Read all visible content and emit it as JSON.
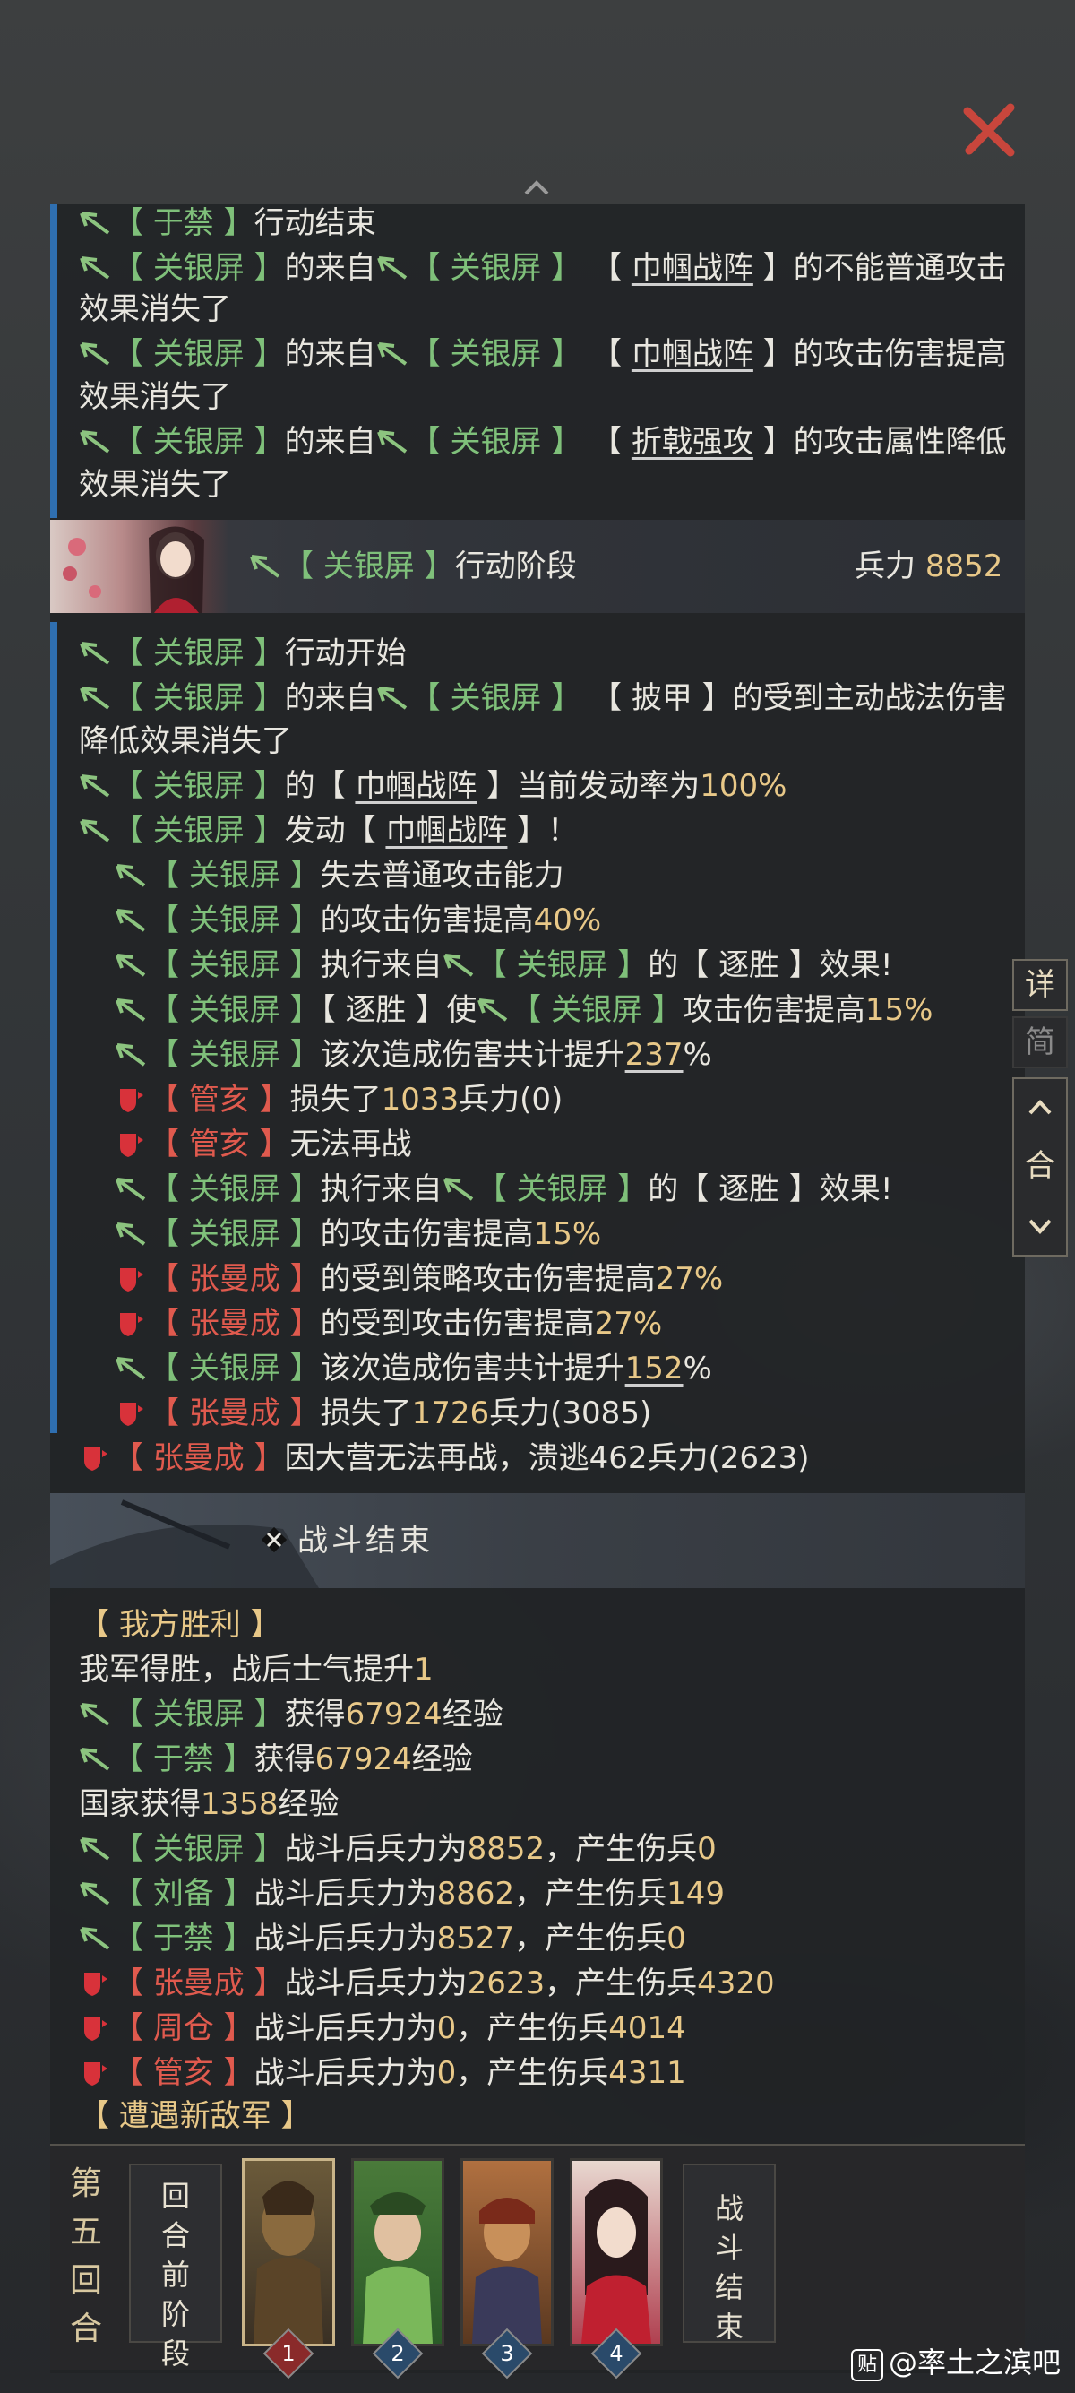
{
  "colors": {
    "ally": "#7fc07a",
    "enemy": "#e05a4e",
    "number": "#e8c888",
    "accent": "#2f6fb0"
  },
  "icons": {
    "ally": "banner-icon",
    "enemy": "shield-icon",
    "close": "close-x-icon"
  },
  "block1": {
    "l1": {
      "name": "于禁",
      "text": "行动结束"
    },
    "l2": {
      "name": "关银屏",
      "t1": "的来自",
      "name2": "关银屏",
      "skill": "巾帼战阵",
      "t2": "的不能普通攻击",
      "cont": "效果消失了"
    },
    "l3": {
      "name": "关银屏",
      "t1": "的来自",
      "name2": "关银屏",
      "skill": "巾帼战阵",
      "t2": "的攻击伤害提高",
      "cont": "效果消失了"
    },
    "l4": {
      "name": "关银屏",
      "t1": "的来自",
      "name2": "关银屏",
      "skill": "折戟强攻",
      "t2": "的攻击属性降低",
      "cont": "效果消失了"
    }
  },
  "phase": {
    "name": "关银屏",
    "label": "行动阶段",
    "troops_label": "兵力",
    "troops": "8852"
  },
  "block2": {
    "a1": {
      "name": "关银屏",
      "text": "行动开始"
    },
    "a2": {
      "name": "关银屏",
      "t1": "的来自",
      "name2": "关银屏",
      "item": "披甲",
      "t2": "的受到主动战法伤害",
      "cont": "降低效果消失了"
    },
    "a3": {
      "name": "关银屏",
      "t1": "的",
      "skill": "巾帼战阵",
      "t2": "当前发动率为",
      "val": "100%"
    },
    "a4": {
      "name": "关银屏",
      "t1": "发动",
      "skill": "巾帼战阵",
      "t2": "！"
    },
    "b1": {
      "name": "关银屏",
      "text": "失去普通攻击能力"
    },
    "b2": {
      "name": "关银屏",
      "t1": "的攻击伤害提高",
      "val": "40%"
    },
    "b3": {
      "name": "关银屏",
      "t1": "执行来自",
      "name2": "关银屏",
      "t2": "的",
      "item": "逐胜",
      "t3": "效果!"
    },
    "b4": {
      "name": "关银屏",
      "item": "逐胜",
      "t1": "使",
      "name2": "关银屏",
      "t2": "攻击伤害提高",
      "val": "15%"
    },
    "b5": {
      "name": "关银屏",
      "t1": "该次造成伤害共计提升",
      "val": "237",
      "t2": "%"
    },
    "b6": {
      "name": "管亥",
      "t1": "损失了",
      "val": "1033",
      "t2": "兵力(0)"
    },
    "b7": {
      "name": "管亥",
      "t1": "无法再战"
    },
    "b8": {
      "name": "关银屏",
      "t1": "执行来自",
      "name2": "关银屏",
      "t2": "的",
      "item": "逐胜",
      "t3": "效果!"
    },
    "b9": {
      "name": "关银屏",
      "t1": "的攻击伤害提高",
      "val": "15%"
    },
    "b10": {
      "name": "张曼成",
      "t1": "的受到策略攻击伤害提高",
      "val": "27%"
    },
    "b11": {
      "name": "张曼成",
      "t1": "的受到攻击伤害提高",
      "val": "27%"
    },
    "b12": {
      "name": "关银屏",
      "t1": "该次造成伤害共计提升",
      "val": "152",
      "t2": "%"
    },
    "b13": {
      "name": "张曼成",
      "t1": "损失了",
      "val": "1726",
      "t2": "兵力(3085)"
    },
    "c1": {
      "name": "张曼成",
      "t1": "因大营无法再战，溃逃462兵力(2623)"
    }
  },
  "battle_end": {
    "label": "战斗结束"
  },
  "result": {
    "title": "【 我方胜利 】",
    "morale": {
      "t1": "我军得胜，战后士气提升",
      "val": "1"
    },
    "exp1": {
      "name": "关银屏",
      "t1": "获得",
      "val": "67924",
      "t2": "经验"
    },
    "exp2": {
      "name": "于禁",
      "t1": "获得",
      "val": "67924",
      "t2": "经验"
    },
    "nation": {
      "t1": "国家获得",
      "val": "1358",
      "t2": "经验"
    },
    "r1": {
      "name": "关银屏",
      "t1": "战斗后兵力为",
      "val": "8852",
      "t2": "，产生伤兵",
      "val2": "0"
    },
    "r2": {
      "name": "刘备",
      "t1": "战斗后兵力为",
      "val": "8862",
      "t2": "，产生伤兵",
      "val2": "149"
    },
    "r3": {
      "name": "于禁",
      "t1": "战斗后兵力为",
      "val": "8527",
      "t2": "，产生伤兵",
      "val2": "0"
    },
    "r4": {
      "name": "张曼成",
      "t1": "战斗后兵力为",
      "val": "2623",
      "t2": "，产生伤兵",
      "val2": "4320"
    },
    "r5": {
      "name": "周仓",
      "t1": "战斗后兵力为",
      "val": "0",
      "t2": "，产生伤兵",
      "val2": "4014"
    },
    "r6": {
      "name": "管亥",
      "t1": "战斗后兵力为",
      "val": "0",
      "t2": "，产生伤兵",
      "val2": "4311"
    },
    "encounter": "【 遭遇新敌军 】"
  },
  "side_buttons": {
    "detail": "详",
    "simple": "简",
    "up": "^",
    "combine": "合",
    "down": "v"
  },
  "tabs": {
    "round_label": [
      "第",
      "五",
      "回",
      "合"
    ],
    "pre_phase": [
      "回",
      "合",
      "前",
      "阶",
      "段"
    ],
    "end": [
      "战",
      "斗",
      "结",
      "束"
    ],
    "numbers": [
      "1",
      "2",
      "3",
      "4"
    ]
  },
  "watermark": {
    "badge": "贴",
    "text": "@率土之滨吧"
  }
}
